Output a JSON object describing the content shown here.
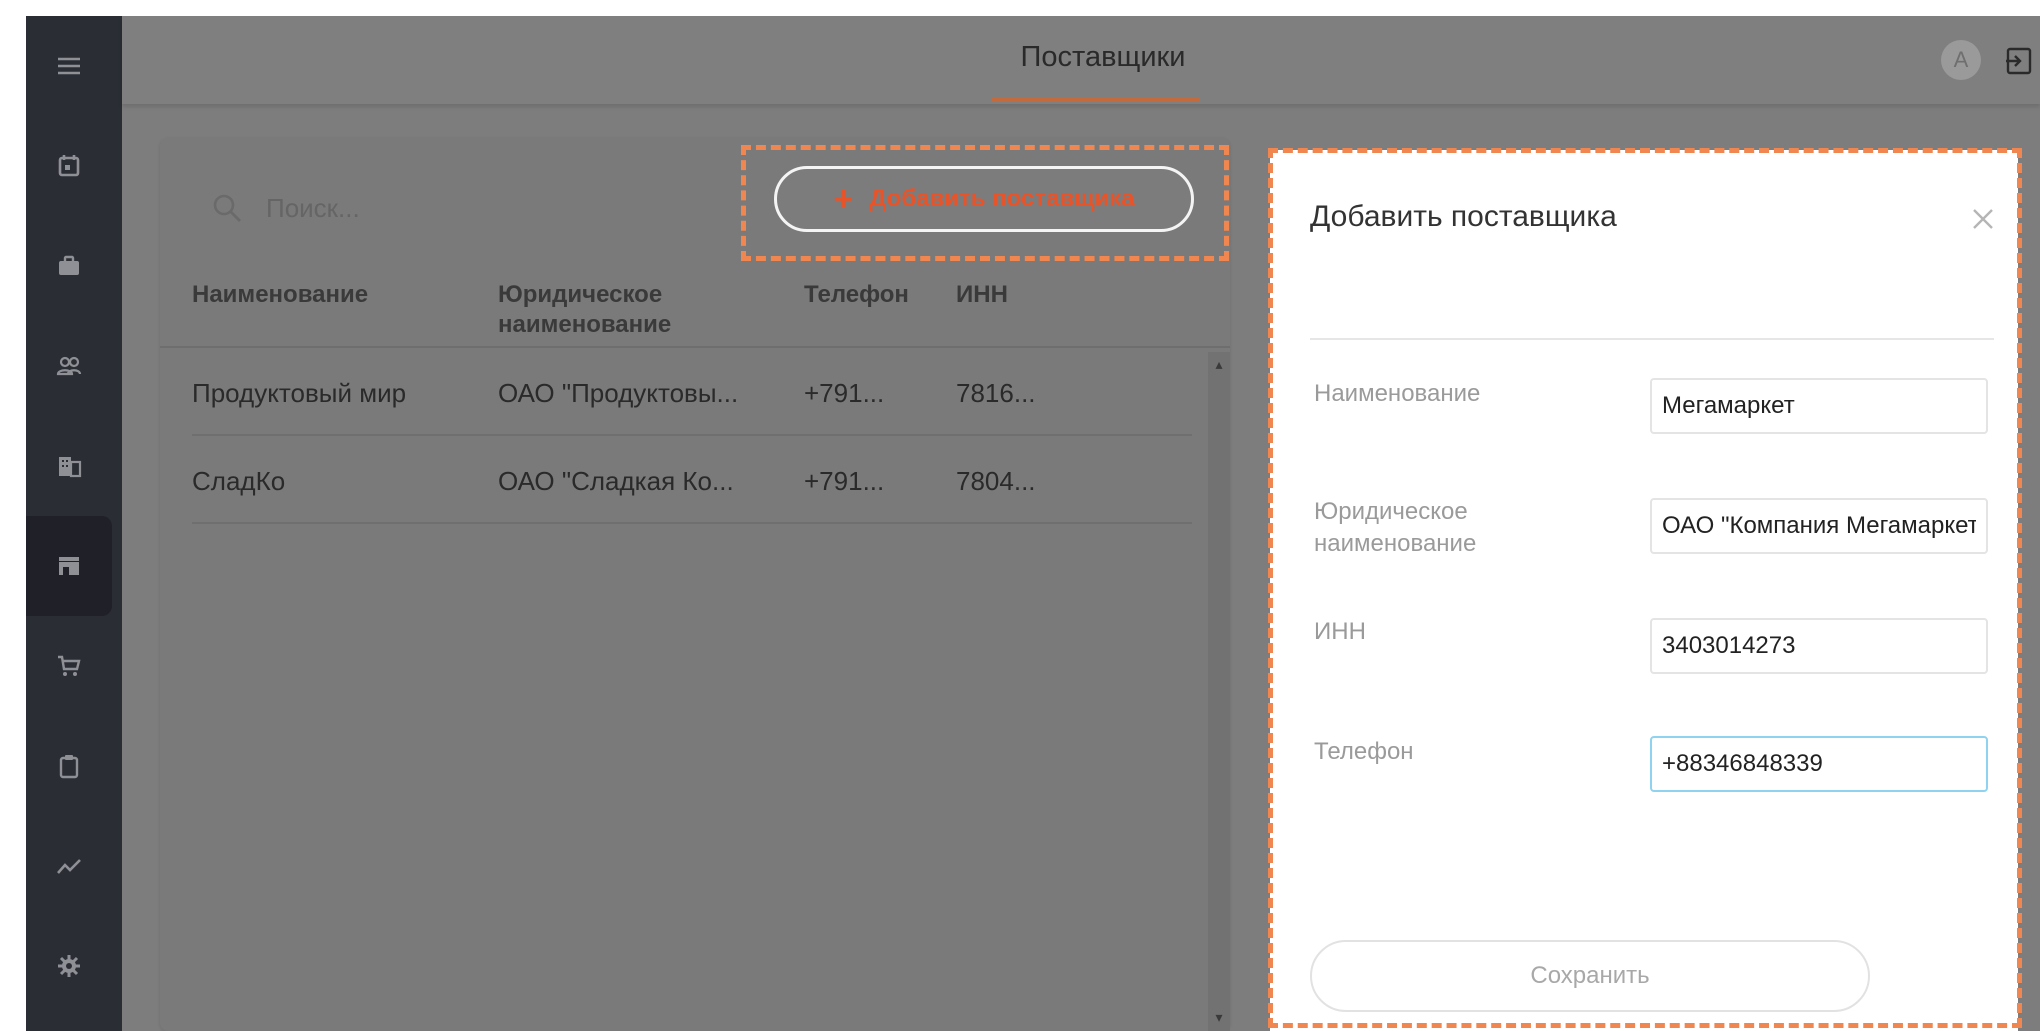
{
  "app": {
    "page_title": "Поставщики",
    "avatar_letter": "A"
  },
  "sidebar": {
    "items": [
      {
        "icon": "menu-icon"
      },
      {
        "icon": "calendar-icon"
      },
      {
        "icon": "briefcase-icon"
      },
      {
        "icon": "people-icon"
      },
      {
        "icon": "building-icon"
      },
      {
        "icon": "store-icon",
        "active": true
      },
      {
        "icon": "cart-icon"
      },
      {
        "icon": "clipboard-icon"
      },
      {
        "icon": "chart-line-icon"
      },
      {
        "icon": "gear-icon"
      }
    ]
  },
  "list": {
    "search_placeholder": "Поиск...",
    "add_button_label": "Добавить поставщика",
    "add_button_plus": "+",
    "columns": [
      "Наименование",
      "Юридическое наименование",
      "Телефон",
      "ИНН"
    ],
    "rows": [
      [
        "Продуктовый мир",
        "ОАО \"Продуктовы...",
        "+791...",
        "7816..."
      ],
      [
        "СладКо",
        "ОАО \"Сладкая Ко...",
        "+791...",
        "7804..."
      ]
    ]
  },
  "form": {
    "title": "Добавить поставщика",
    "fields": [
      {
        "label": "Наименование",
        "value": "Мегамаркет"
      },
      {
        "label": "Юридическое наименование",
        "value": "ОАО \"Компания Мегамаркет\""
      },
      {
        "label": "ИНН",
        "value": "3403014273"
      },
      {
        "label": "Телефон",
        "value": "+88346848339"
      }
    ],
    "save_label": "Сохранить"
  },
  "colors": {
    "accent": "#e8542a",
    "highlight_outline": "#f08750",
    "sidebar_bg": "#2b2d35",
    "focus_border": "#8fd3f0"
  }
}
